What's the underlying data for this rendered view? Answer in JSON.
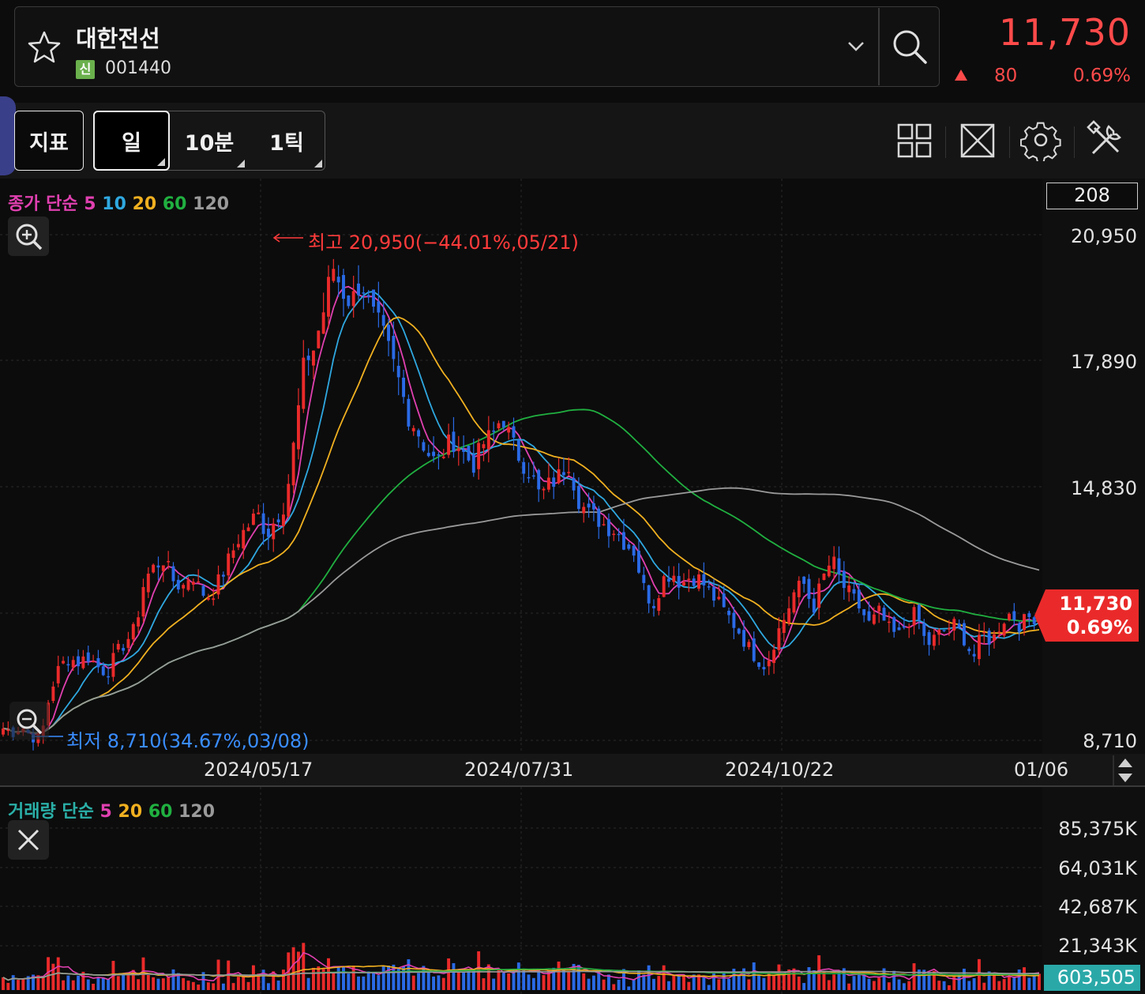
{
  "header": {
    "stock_name": "대한전선",
    "credit_badge": "신",
    "stock_code": "001440",
    "price": "11,730",
    "change": "80",
    "change_pct": "0.69%",
    "direction": "up",
    "up_color": "#ff4a4a"
  },
  "toolbar": {
    "indicator_label": "지표",
    "periods": [
      "일",
      "10분",
      "1틱"
    ],
    "selected_period": "일",
    "icons": [
      "grid-layout-icon",
      "fullscreen-icon",
      "settings-gear-icon",
      "tools-icon"
    ]
  },
  "price_chart": {
    "legend": {
      "label": "종가 단순",
      "periods": [
        "5",
        "10",
        "20",
        "60",
        "120"
      ],
      "colors": [
        "#e040b0",
        "#2fa8e0",
        "#f0b020",
        "#20b040",
        "#9a9a9a"
      ]
    },
    "candle_count_label": "208",
    "y_ticks": [
      "20,950",
      "17,890",
      "14,830",
      "8,710"
    ],
    "x_ticks": [
      "2024/05/17",
      "2024/07/31",
      "2024/10/22",
      "01/06"
    ],
    "high_annotation": "최고 20,950(−44.01%,05/21)",
    "low_annotation": "최저 8,710(34.67%,03/08)",
    "current_price_tag": {
      "price": "11,730",
      "pct": "0.69%"
    },
    "up_color": "#ea2a2a",
    "down_color": "#2a6ae6"
  },
  "volume_chart": {
    "legend": {
      "label": "거래량 단순",
      "periods": [
        "5",
        "20",
        "60",
        "120"
      ],
      "colors": [
        "#e040b0",
        "#f0b020",
        "#20b040",
        "#9a9a9a"
      ]
    },
    "y_ticks": [
      "85,375K",
      "64,031K",
      "42,687K",
      "21,343K"
    ],
    "current_volume": "603,505"
  },
  "chart_data": {
    "type": "candlestick",
    "y_range": [
      8710,
      20950
    ],
    "approx_daily_closes": [
      9000,
      8900,
      9050,
      8800,
      8750,
      9900,
      10500,
      10700,
      10600,
      10750,
      10500,
      10350,
      10800,
      11100,
      11400,
      12600,
      12900,
      13100,
      12600,
      12400,
      12800,
      12300,
      12200,
      12600,
      13100,
      13600,
      13900,
      14200,
      13700,
      14100,
      14500,
      16100,
      17900,
      18200,
      19100,
      20200,
      19600,
      19300,
      19900,
      19100,
      18700,
      18100,
      17400,
      16600,
      16200,
      15700,
      15400,
      15800,
      16000,
      15600,
      15400,
      15900,
      16100,
      16600,
      15900,
      15500,
      15200,
      14600,
      14900,
      15100,
      15500,
      14600,
      14200,
      14100,
      13900,
      13800,
      13500,
      13300,
      12400,
      12000,
      12600,
      12800,
      12500,
      12700,
      12600,
      12300,
      12000,
      11700,
      11400,
      11000,
      10700,
      10500,
      11200,
      11700,
      12300,
      12500,
      11900,
      12600,
      13100,
      12500,
      12200,
      11900,
      11500,
      11800,
      11400,
      11200,
      11600,
      11800,
      11000,
      11200,
      11400,
      11500,
      11200,
      10700,
      11300,
      11100,
      11600,
      11800,
      11500,
      11700,
      11730
    ],
    "ma_series": [
      {
        "name": "5",
        "color": "#e040b0"
      },
      {
        "name": "10",
        "color": "#2fa8e0"
      },
      {
        "name": "20",
        "color": "#f0b020"
      },
      {
        "name": "60",
        "color": "#20b040"
      },
      {
        "name": "120",
        "color": "#9a9a9a"
      }
    ]
  }
}
